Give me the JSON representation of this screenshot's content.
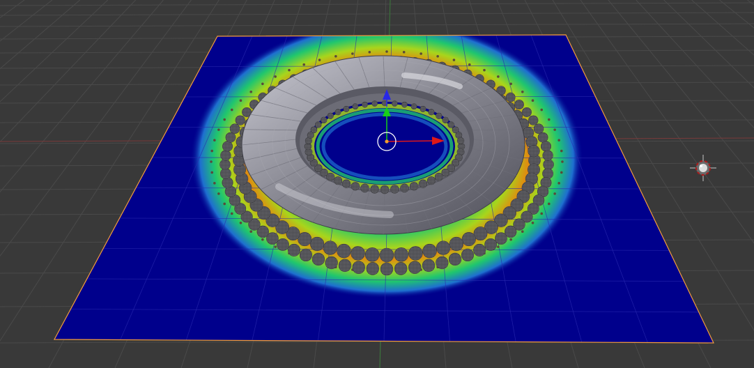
{
  "viewport": {
    "background_color": "#393939",
    "grid_color": "#4a4a4a",
    "axis_x_color": "#7a3a3a",
    "axis_y_color": "#3a7a3a"
  },
  "plane": {
    "selection_outline_color": "#f39c3c",
    "weight_paint_colors": {
      "low": "#00008c",
      "mid_low": "#1e6fd0",
      "mid": "#1fc66e",
      "mid_high": "#a8d51c",
      "high": "#e08a10"
    }
  },
  "torus": {
    "base_color": "#8a8a94",
    "highlight_color": "#c9c9d2",
    "shadow_color": "#4e4e58"
  },
  "spheres": {
    "color": "#6c6c70",
    "wire_color": "#3e3e42"
  },
  "gizmo": {
    "x_color": "#e01818",
    "y_color": "#18d018",
    "z_color": "#2828e6",
    "origin_color": "#f0a030",
    "ring_color": "#ffffff"
  },
  "lamp": {
    "icon": "lamp-icon",
    "color": "#c8c8c8",
    "accent_color": "#b01818"
  }
}
